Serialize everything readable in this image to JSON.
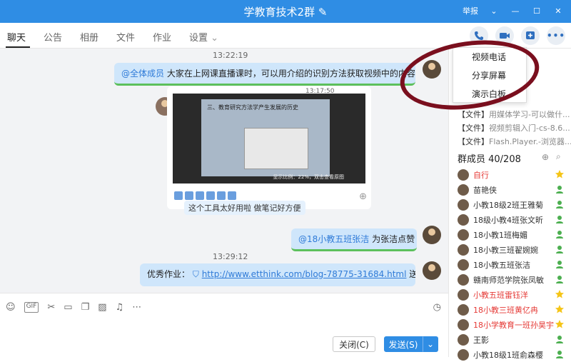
{
  "titlebar": {
    "title": "学教育技术2群",
    "report": "举报"
  },
  "tabs": [
    "聊天",
    "公告",
    "相册",
    "文件",
    "作业",
    "设置"
  ],
  "chat": {
    "ts1": "13:22:19",
    "msg1_mention": "@全体成员",
    "msg1_text": "大家在上网课直播课时，可以用介绍的识别方法获取视频中的内容",
    "img_time": "13:17:50",
    "img_slide_text": "三、教育研究方法学产生发展的历史",
    "img_scale": "显示比例：22%，双击查看原图",
    "img_caption": "这个工具太好用啦 做笔记好方便",
    "msg2_mention": "@18小教五班张洁",
    "msg2_text": "为张洁点赞",
    "ts2": "13:29:12",
    "msg3_prefix": "优秀作业：",
    "msg3_link": "http://www.etthink.com/blog-78775-31684.html",
    "msg3_suffix": "送花"
  },
  "input": {
    "close_label": "关闭(C)",
    "send_label": "发送(S)"
  },
  "dropdown": [
    "视频电话",
    "分享屏幕",
    "演示白板"
  ],
  "files": [
    {
      "tag": "【文件】",
      "name": "用媒体学习-可以做什..."
    },
    {
      "tag": "【文件】",
      "name": "视频剪辑入门-cs-8.6..."
    },
    {
      "tag": "【文件】",
      "name": "Flash.Player.-浏览器..."
    }
  ],
  "members_header": "群成员 40/208",
  "members": [
    {
      "name": "自行",
      "red": true
    },
    {
      "name": "苗艳侠",
      "red": false
    },
    {
      "name": "小教18级2班王雅菊",
      "red": false
    },
    {
      "name": "18级小教4班张文昕",
      "red": false
    },
    {
      "name": "18小教1班梅媚",
      "red": false
    },
    {
      "name": "18小教三班翟婉婉",
      "red": false
    },
    {
      "name": "18小教五班张洁",
      "red": false
    },
    {
      "name": "赣南师范学院张凤敏",
      "red": false
    },
    {
      "name": "小教五班雷钰洋",
      "red": true
    },
    {
      "name": "18小教三班黄亿冉",
      "red": true
    },
    {
      "name": "18小学教育一班孙昊宇",
      "red": true
    },
    {
      "name": "王影",
      "red": false
    },
    {
      "name": "小教18级1班俞森樱",
      "red": false
    }
  ],
  "colors": {
    "accent": "#2f8de4",
    "bubble": "#cfe6fb",
    "highlight_oval": "#7a0f1e",
    "admin_red": "#e53935"
  }
}
